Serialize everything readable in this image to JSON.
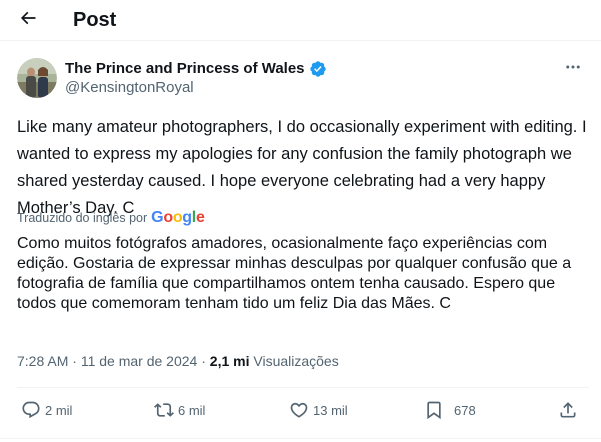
{
  "header": {
    "title": "Post"
  },
  "author": {
    "name": "The Prince and Princess of Wales",
    "handle": "@KensingtonRoyal"
  },
  "tweet": {
    "text": "Like many amateur photographers, I do occasionally experiment with editing. I wanted to express my apologies for any confusion the family photograph we shared yesterday caused. I hope everyone celebrating had a very happy Mother’s Day. C",
    "translated_by_label": "Traduzido do inglês por",
    "translation_provider": "Google",
    "translation": "Como muitos fotógrafos amadores, ocasionalmente faço experiências com edição. Gostaria de expressar minhas desculpas por qualquer confusão que a fotografia de família que compartilhamos ontem tenha causado. Espero que todos que comemoram tenham tido um feliz Dia das Mães. C"
  },
  "meta": {
    "time": "7:28 AM",
    "separator": " · ",
    "date": "11 de mar de 2024",
    "views_count": "2,1 mi",
    "views_label": "Visualizações"
  },
  "actions": {
    "replies": "2 mil",
    "reposts": "6 mil",
    "likes": "13 mil",
    "bookmarks": "678"
  },
  "icons": {
    "back": "arrow-left-icon",
    "verified": "verified-badge-icon",
    "more": "more-dots-icon",
    "reply": "reply-icon",
    "repost": "repost-icon",
    "like": "heart-icon",
    "bookmark": "bookmark-icon",
    "share": "share-icon"
  },
  "colors": {
    "verified_blue": "#1d9bf0",
    "secondary_text": "#536471",
    "google_blue": "#4285f4",
    "google_red": "#ea4335",
    "google_yellow": "#fbbc05",
    "google_green": "#34a853"
  }
}
